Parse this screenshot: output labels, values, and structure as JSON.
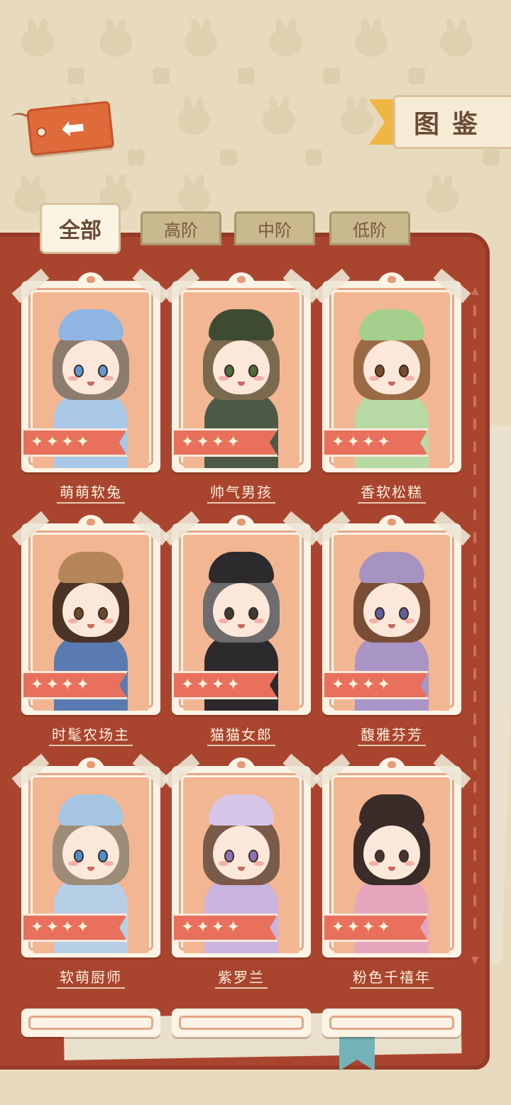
{
  "header": {
    "back_icon": "arrow-left-icon",
    "title": "图鉴"
  },
  "tabs": [
    {
      "label": "全部",
      "active": true
    },
    {
      "label": "高阶",
      "active": false
    },
    {
      "label": "中阶",
      "active": false
    },
    {
      "label": "低阶",
      "active": false
    }
  ],
  "cards": [
    {
      "name": "萌萌软兔",
      "stars": 4,
      "hair": "#8c7c6e",
      "outfit": "#a9c7e6",
      "hat": "#8fb6e3",
      "eye": "#5e9ad1"
    },
    {
      "name": "帅气男孩",
      "stars": 4,
      "hair": "#7b6a4e",
      "outfit": "#4d5a45",
      "hat": "#3f4a32",
      "eye": "#4e6d3c"
    },
    {
      "name": "香软松糕",
      "stars": 4,
      "hair": "#9a6a44",
      "outfit": "#b7d9a4",
      "hat": "#a5cf8c",
      "eye": "#7a4b2a"
    },
    {
      "name": "时髦农场主",
      "stars": 4,
      "hair": "#4a3426",
      "outfit": "#5a7bb1",
      "hat": "#b48658",
      "eye": "#6b4a2a"
    },
    {
      "name": "猫猫女郎",
      "stars": 4,
      "hair": "#6e6c6c",
      "outfit": "#2c2a2c",
      "hat": "#2c2a2c",
      "eye": "#3e3a34"
    },
    {
      "name": "馥雅芬芳",
      "stars": 4,
      "hair": "#7a4e36",
      "outfit": "#a995c6",
      "hat": "#a793c2",
      "eye": "#5f5fa0"
    },
    {
      "name": "软萌厨师",
      "stars": 4,
      "hair": "#9c8c78",
      "outfit": "#b6cfe7",
      "hat": "#a7c4e2",
      "eye": "#4f8ec9"
    },
    {
      "name": "紫罗兰",
      "stars": 4,
      "hair": "#7a5a48",
      "outfit": "#c9b3df",
      "hat": "#d7c6e8",
      "eye": "#8a73b5"
    },
    {
      "name": "粉色千禧年",
      "stars": 4,
      "hair": "#3a2c28",
      "outfit": "#e5a6bd",
      "hat": "#3a2c28",
      "eye": "#4a3630"
    }
  ],
  "colors": {
    "book": "#a9452f",
    "star_banner": "#e8705c",
    "card_inner": "#f3b692",
    "back_tag": "#df6a3a",
    "title_ribbon": "#f0b644"
  }
}
